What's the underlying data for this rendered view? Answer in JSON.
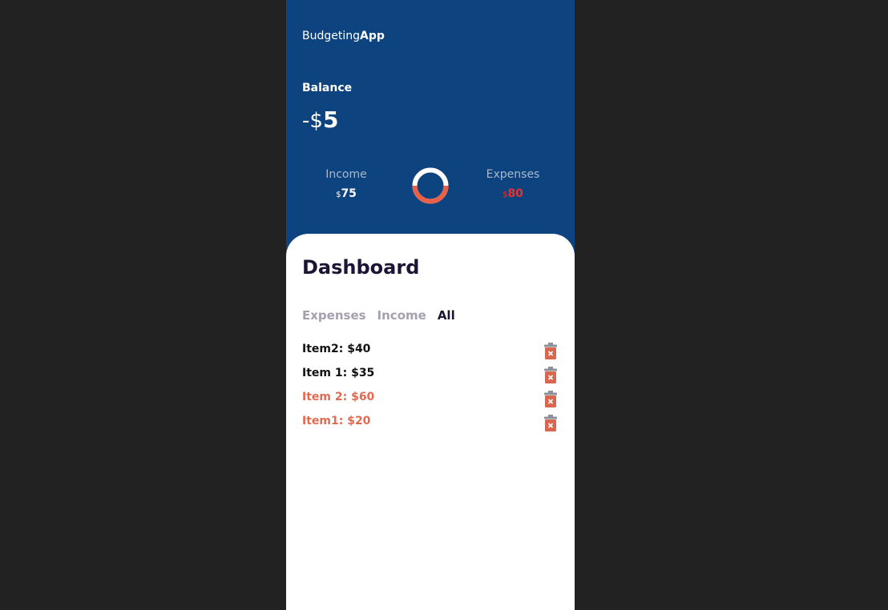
{
  "brand": {
    "prefix": "Budgeting",
    "suffix": "App"
  },
  "balance": {
    "label": "Balance",
    "sign": "-$",
    "amount": "5"
  },
  "summary": {
    "income": {
      "title": "Income",
      "currency": "$",
      "amount": "75"
    },
    "expenses": {
      "title": "Expenses",
      "currency": "$",
      "amount": "80"
    }
  },
  "donut": {
    "income_color": "#ffffff",
    "expense_color": "#e8604a",
    "expense_fraction": 0.5
  },
  "dashboard": {
    "title": "Dashboard",
    "tabs": [
      "Expenses",
      "Income",
      "All"
    ],
    "active_tab": "All",
    "items": [
      {
        "label": "Item2: $40",
        "kind": "expense"
      },
      {
        "label": "Item 1: $35",
        "kind": "expense"
      },
      {
        "label": "Item 2: $60",
        "kind": "income"
      },
      {
        "label": "Item1: $20",
        "kind": "income"
      }
    ],
    "delete_icon": "trash-icon"
  },
  "colors": {
    "header_bg": "#0d437f",
    "page_bg": "#222222",
    "expense_red": "#e8322f",
    "income_orange": "#e26a50",
    "dark_text": "#1e1436"
  }
}
